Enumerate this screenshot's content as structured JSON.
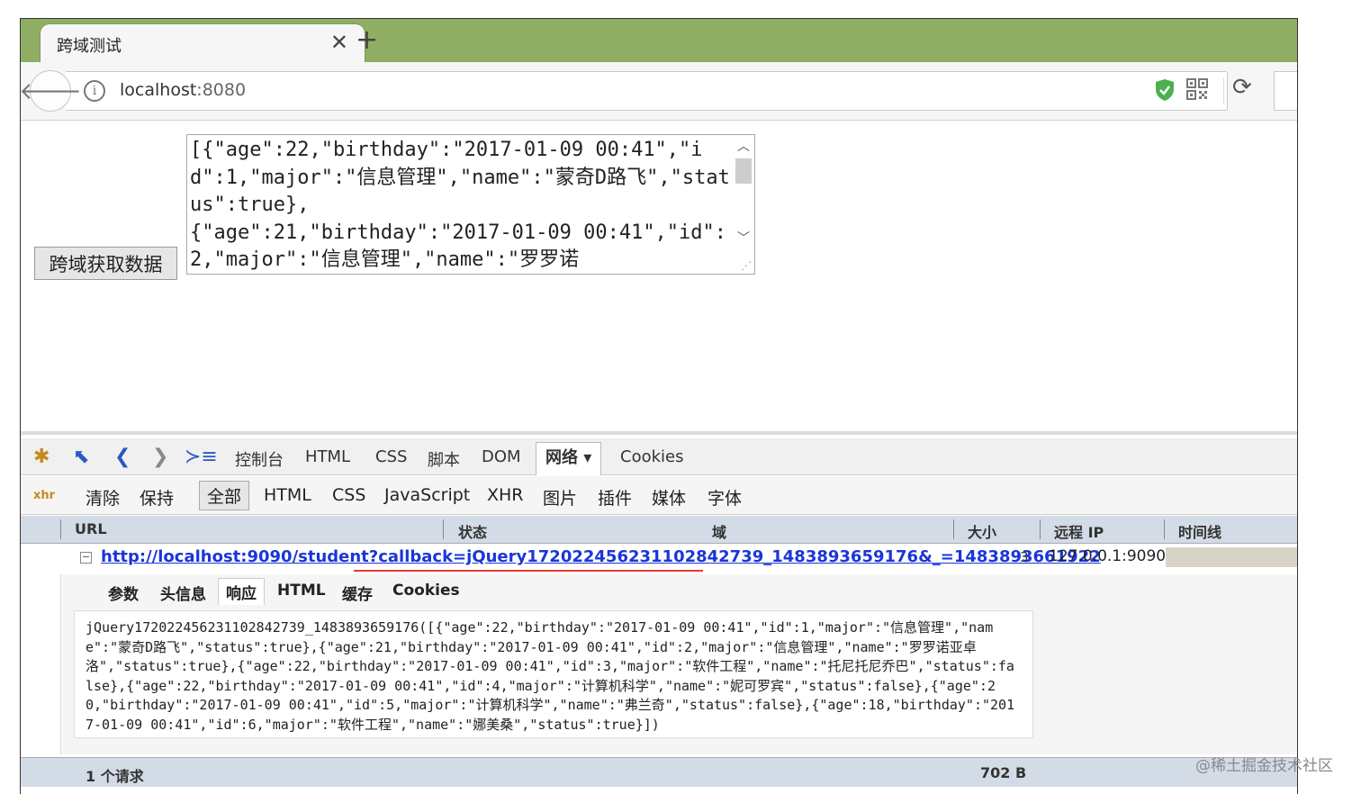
{
  "browser": {
    "tab_title": "跨域测试",
    "tab_close": "✕",
    "new_tab": "+",
    "url_host": "localhost",
    "url_port": ":8080",
    "info_glyph": "i",
    "back_glyph": "🡐",
    "reload_glyph": "⟳",
    "icons": [
      "back-arrow-icon",
      "info-icon",
      "shield-icon",
      "qr-code-icon",
      "reload-icon",
      "search-icon"
    ]
  },
  "page": {
    "fetch_button_label": "跨域获取数据",
    "textarea_value": "[{\"age\":22,\"birthday\":\"2017-01-09 00:41\",\"id\":1,\"major\":\"信息管理\",\"name\":\"蒙奇D路飞\",\"status\":true},\n{\"age\":21,\"birthday\":\"2017-01-09 00:41\",\"id\":2,\"major\":\"信息管理\",\"name\":\"罗罗诺"
  },
  "firebug": {
    "main_tabs": [
      "控制台",
      "HTML",
      "CSS",
      "脚本",
      "DOM",
      "网络 ▾",
      "Cookies"
    ],
    "filters": [
      "清除",
      "保持",
      "全部",
      "HTML",
      "CSS",
      "JavaScript",
      "XHR",
      "图片",
      "插件",
      "媒体",
      "字体"
    ],
    "columns": [
      "URL",
      "状态",
      "域",
      "大小",
      "远程 IP",
      "时间线"
    ],
    "request": {
      "url": "http://localhost:9090/student?callback=jQuery172022456231102842739_1483893659176&_=1483893661922",
      "clipped_size": "3",
      "remote_ip": "127.0.0.1:9090"
    },
    "detail_tabs": [
      "参数",
      "头信息",
      "响应",
      "HTML",
      "缓存",
      "Cookies"
    ],
    "response_text": "jQuery172022456231102842739_1483893659176([{\"age\":22,\"birthday\":\"2017-01-09 00:41\",\"id\":1,\"major\":\"信息管理\",\"name\":\"蒙奇D路飞\",\"status\":true},{\"age\":21,\"birthday\":\"2017-01-09 00:41\",\"id\":2,\"major\":\"信息管理\",\"name\":\"罗罗诺亚卓洛\",\"status\":true},{\"age\":22,\"birthday\":\"2017-01-09 00:41\",\"id\":3,\"major\":\"软件工程\",\"name\":\"托尼托尼乔巴\",\"status\":false},{\"age\":22,\"birthday\":\"2017-01-09 00:41\",\"id\":4,\"major\":\"计算机科学\",\"name\":\"妮可罗宾\",\"status\":false},{\"age\":20,\"birthday\":\"2017-01-09 00:41\",\"id\":5,\"major\":\"计算机科学\",\"name\":\"弗兰奇\",\"status\":false},{\"age\":18,\"birthday\":\"2017-01-09 00:41\",\"id\":6,\"major\":\"软件工程\",\"name\":\"娜美桑\",\"status\":true}])",
    "status_count": "1 个请求",
    "status_size": "702 B"
  },
  "watermark": "@稀土掘金技术社区",
  "colors": {
    "tabstrip": "#8fae64",
    "link": "#1a35d8",
    "underline_accent": "#e53935",
    "firebug_header": "#d3dbe6"
  }
}
